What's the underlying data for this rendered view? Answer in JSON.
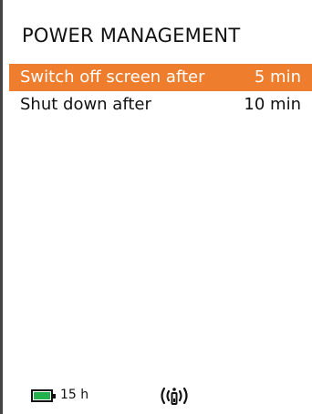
{
  "header": {
    "title": "POWER MANAGEMENT"
  },
  "menu": {
    "items": [
      {
        "label": "Switch off screen after",
        "value": "5 min",
        "selected": true
      },
      {
        "label": "Shut down after",
        "value": "10 min",
        "selected": false
      }
    ]
  },
  "status": {
    "battery_text": "15 h",
    "battery_level": 1.0,
    "battery_icon": "battery-icon",
    "signal_icon": "wireless-transmitter-icon"
  },
  "colors": {
    "selection": "#ee7d2e",
    "battery_fill": "#22b14c",
    "background": "#ffffff",
    "text": "#111111"
  }
}
